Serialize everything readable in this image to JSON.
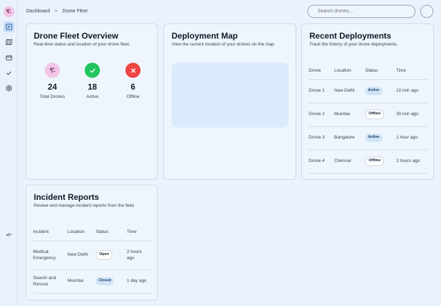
{
  "breadcrumb": {
    "root": "Dashboard",
    "separator": ">",
    "current": "Drone Fleet"
  },
  "search": {
    "placeholder": "Search drones..."
  },
  "sidebar": {
    "icons": [
      "drone-logo-icon",
      "dashboard-icon",
      "map-icon",
      "credit-card-icon",
      "check-icon",
      "settings-icon",
      "drone-icon"
    ]
  },
  "overview": {
    "title": "Drone Fleet Overview",
    "subtitle": "Real-time status and location of your drone fleet.",
    "stats": [
      {
        "value": "24",
        "label": "Total Drones",
        "color": "#f3c6e6",
        "icon": "drone-icon"
      },
      {
        "value": "18",
        "label": "Active",
        "color": "#22c55e",
        "icon": "check-icon"
      },
      {
        "value": "6",
        "label": "Offline",
        "color": "#ef4444",
        "icon": "x-icon"
      }
    ]
  },
  "map": {
    "title": "Deployment Map",
    "subtitle": "View the current location of your drones on the map."
  },
  "deployments": {
    "title": "Recent Deployments",
    "subtitle": "Track the history of your drone deployments.",
    "columns": [
      "Drone",
      "Location",
      "Status",
      "Time"
    ],
    "rows": [
      [
        "Drone 1",
        "New Delhi",
        "Active",
        "10 min ago"
      ],
      [
        "Drone 2",
        "Mumbai",
        "Offline",
        "30 min ago"
      ],
      [
        "Drone 3",
        "Bangalore",
        "Active",
        "1 hour ago"
      ],
      [
        "Drone 4",
        "Chennai",
        "Offline",
        "2 hours ago"
      ]
    ]
  },
  "incidents": {
    "title": "Incident Reports",
    "subtitle": "Review and manage incident reports from the field.",
    "columns": [
      "Incident",
      "Location",
      "Status",
      "Time"
    ],
    "rows": [
      [
        "Medical Emergency",
        "New Delhi",
        "Open",
        "2 hours ago"
      ],
      [
        "Search and Rescue",
        "Mumbai",
        "Closed",
        "1 day ago"
      ]
    ]
  }
}
